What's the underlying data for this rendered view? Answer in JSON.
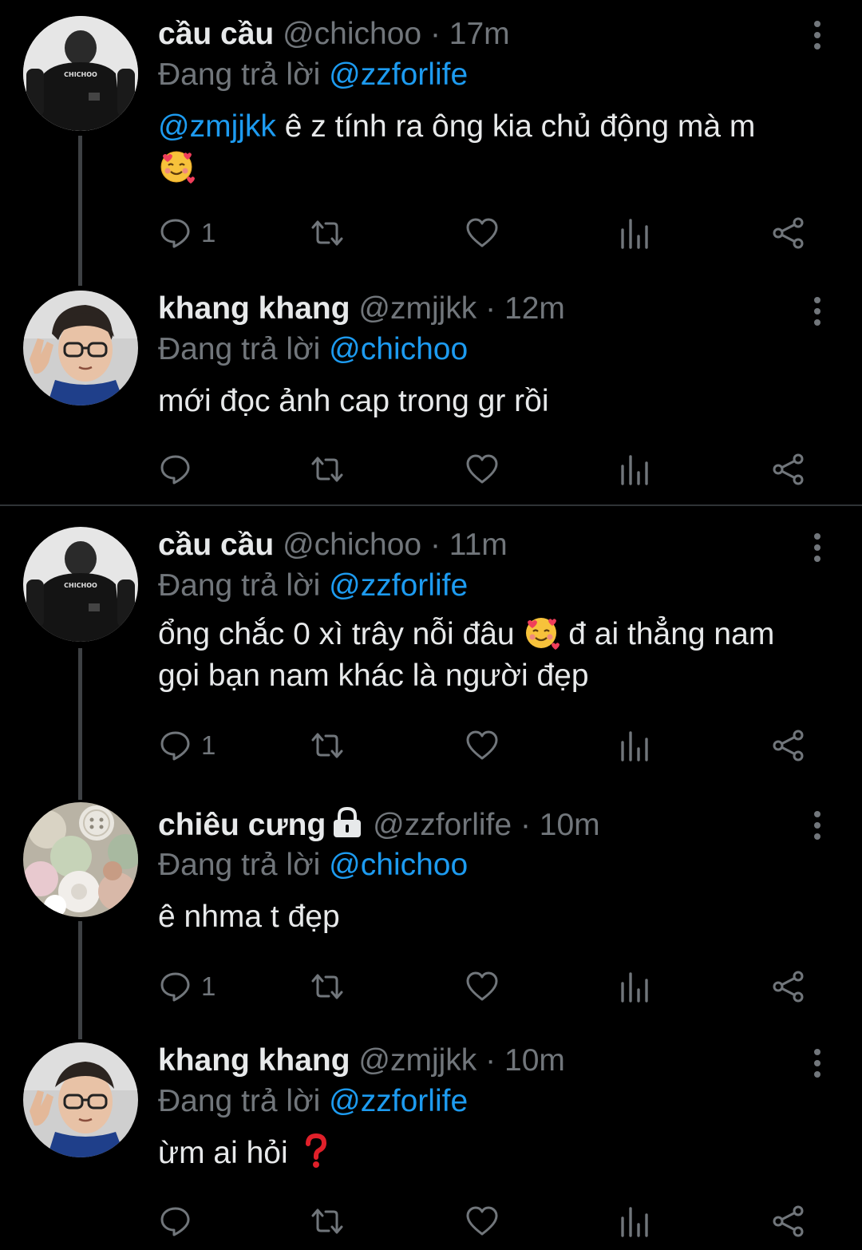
{
  "tweets": [
    {
      "name": "cầu cầu",
      "handle": "@chichoo",
      "dot": "·",
      "time": "17m",
      "replying_prefix": "Đang trả lời ",
      "replying_to": "@zzforlife",
      "mention": "@zmjjkk",
      "text": " ê z tính ra ông kia chủ động mà m",
      "reply_count": "1",
      "avatar_icon": "avatar-dark-shirt",
      "avatar_text": "CHICHOO"
    },
    {
      "name": "khang khang",
      "handle": "@zmjjkk",
      "dot": "·",
      "time": "12m",
      "replying_prefix": "Đang trả lời ",
      "replying_to": "@chichoo",
      "text": "mới đọc ảnh cap trong gr rồi",
      "reply_count": "",
      "avatar_icon": "avatar-glasses-person"
    },
    {
      "name": "cầu cầu",
      "handle": "@chichoo",
      "dot": "·",
      "time": "11m",
      "replying_prefix": "Đang trả lời ",
      "replying_to": "@zzforlife",
      "text_a": "ổng chắc 0 xì trây nỗi đâu ",
      "text_b": " đ ai thẳng nam gọi bạn nam khác là người đẹp",
      "reply_count": "1",
      "avatar_icon": "avatar-dark-shirt",
      "avatar_text": "CHICHOO"
    },
    {
      "name": "chiêu cưng",
      "handle": "@zzforlife",
      "dot": "·",
      "time": "10m",
      "replying_prefix": "Đang trả lời ",
      "replying_to": "@chichoo",
      "text": "ê nhma t đẹp",
      "reply_count": "1",
      "avatar_icon": "avatar-buttons",
      "protected_icon": "lock-icon"
    },
    {
      "name": "khang khang",
      "handle": "@zmjjkk",
      "dot": "·",
      "time": "10m",
      "replying_prefix": "Đang trả lời ",
      "replying_to": "@zzforlife",
      "text": "ừm ai hỏi ",
      "reply_count": "",
      "avatar_icon": "avatar-glasses-person",
      "trailing_emoji": "red-question-mark-icon"
    }
  ],
  "icons": {
    "reply": "reply-icon",
    "retweet": "retweet-icon",
    "like": "heart-icon",
    "views": "views-icon",
    "share": "share-icon",
    "more": "more-vertical-icon",
    "emoji": "smiling-face-with-hearts-icon"
  },
  "colors": {
    "background": "#000000",
    "text": "#e7e9ea",
    "secondary": "#71767b",
    "mention": "#1d9bf0",
    "thread_line": "#3e4144"
  }
}
